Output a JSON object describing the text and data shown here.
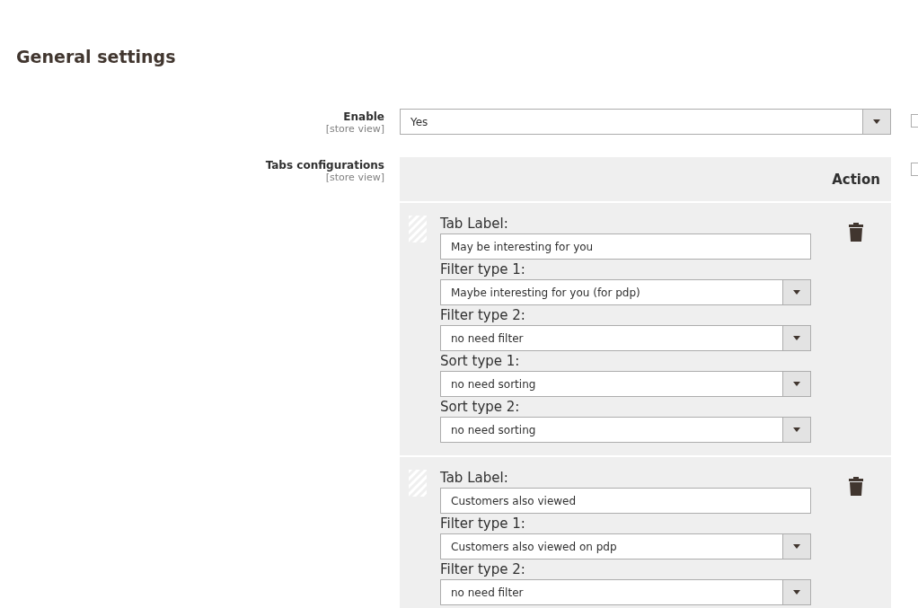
{
  "section_title": "General settings",
  "settings": [
    {
      "label": "Enable",
      "scope": "[store view]",
      "kind": "select",
      "value": "Yes",
      "use_default": {
        "checked": false
      }
    },
    {
      "label": "Tabs configurations",
      "scope": "[store view]",
      "kind": "table",
      "use_default": {
        "checked": false
      },
      "table": {
        "action_header": "Action",
        "rows": [
          {
            "fields": [
              {
                "label": "Tab Label:",
                "kind": "text",
                "value": "May be interesting for you"
              },
              {
                "label": "Filter type 1:",
                "kind": "select",
                "value": "Maybe interesting for you (for pdp)"
              },
              {
                "label": "Filter type 2:",
                "kind": "select",
                "value": "no need filter"
              },
              {
                "label": "Sort type 1:",
                "kind": "select",
                "value": "no need sorting"
              },
              {
                "label": "Sort type 2:",
                "kind": "select",
                "value": "no need sorting"
              }
            ]
          },
          {
            "fields": [
              {
                "label": "Tab Label:",
                "kind": "text",
                "value": "Customers also viewed"
              },
              {
                "label": "Filter type 1:",
                "kind": "select",
                "value": "Customers also viewed on pdp"
              },
              {
                "label": "Filter type 2:",
                "kind": "select",
                "value": "no need filter"
              }
            ]
          }
        ]
      }
    }
  ]
}
